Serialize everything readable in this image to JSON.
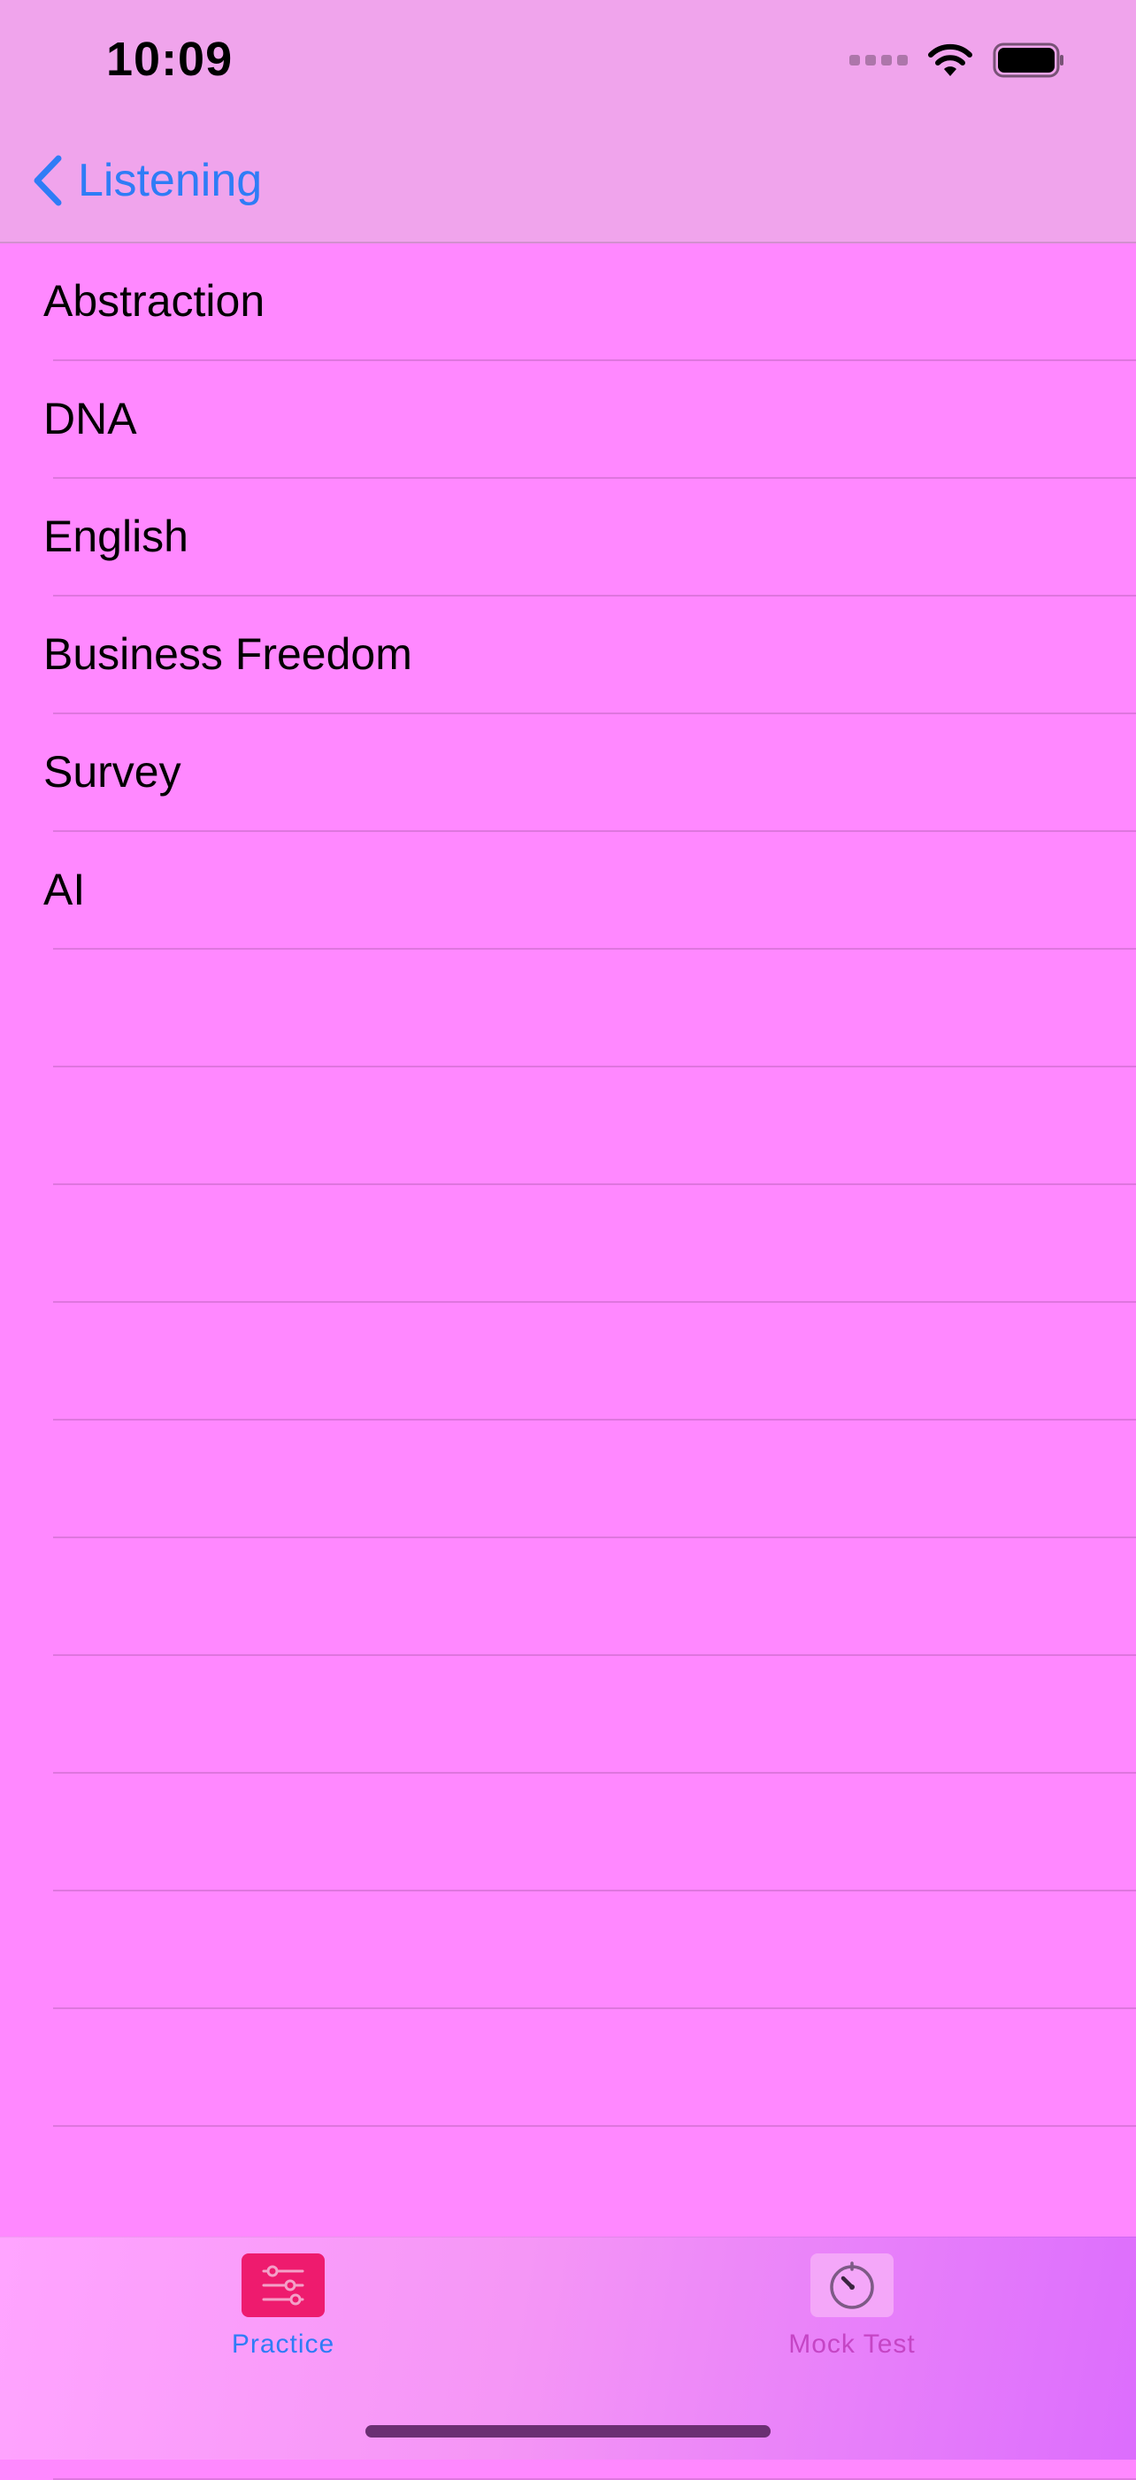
{
  "status_bar": {
    "time": "10:09"
  },
  "nav": {
    "back_label": "Listening"
  },
  "list": {
    "items": [
      "Abstraction",
      "DNA",
      "English",
      "Business Freedom",
      "Survey",
      "AI"
    ]
  },
  "tabbar": {
    "practice_label": "Practice",
    "mock_test_label": "Mock Test"
  },
  "colors": {
    "background": "#FF88FF",
    "nav_background": "#F0A4EC",
    "accent": "#2F7CF6",
    "practice_icon_bg": "#EE1B6E",
    "mock_label": "#C545C5"
  }
}
